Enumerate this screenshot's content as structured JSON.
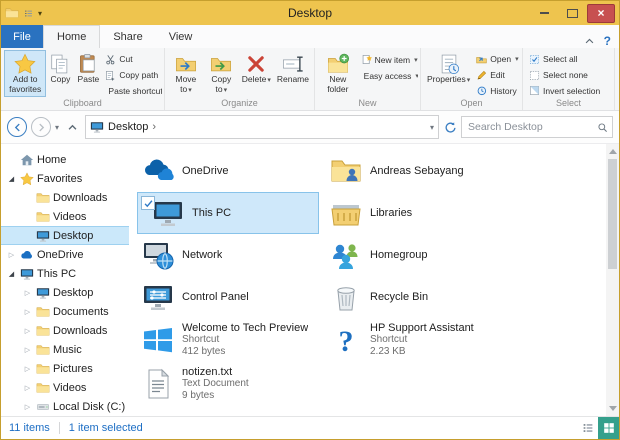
{
  "colors": {
    "titlebar_gold": "#eec44e",
    "file_tab_blue": "#2a72c0",
    "selection_blue": "#cbe8fa",
    "status_text_blue": "#1d6ec4",
    "active_view_teal": "#35a08c",
    "close_button_red": "#c75050"
  },
  "titlebar": {
    "title": "Desktop"
  },
  "ribbon": {
    "file_tab": "File",
    "tabs": [
      {
        "label": "Home",
        "active": true
      },
      {
        "label": "Share",
        "active": false
      },
      {
        "label": "View",
        "active": false
      }
    ],
    "help": "?",
    "groups": {
      "clipboard": {
        "label": "Clipboard",
        "add_to_favorites": "Add to favorites",
        "copy": "Copy",
        "paste": "Paste",
        "cut": "Cut",
        "copy_path": "Copy path",
        "paste_shortcut": "Paste shortcut"
      },
      "organize": {
        "label": "Organize",
        "move_to": "Move to",
        "copy_to": "Copy to",
        "delete": "Delete",
        "rename": "Rename"
      },
      "new": {
        "label": "New",
        "new_folder": "New folder",
        "new_item": "New item",
        "easy_access": "Easy access"
      },
      "open": {
        "label": "Open",
        "properties": "Properties",
        "open": "Open",
        "edit": "Edit",
        "history": "History"
      },
      "select": {
        "label": "Select",
        "select_all": "Select all",
        "select_none": "Select none",
        "invert_selection": "Invert selection"
      }
    }
  },
  "addressbar": {
    "breadcrumb_root": "Desktop",
    "search_placeholder": "Search Desktop"
  },
  "sidebar": {
    "items": [
      {
        "label": "Home",
        "icon": "home-icon",
        "level": 0,
        "expander": "none"
      },
      {
        "label": "Favorites",
        "icon": "star-icon",
        "level": 0,
        "expander": "expanded"
      },
      {
        "label": "Downloads",
        "icon": "folder-icon",
        "level": 1,
        "expander": "none"
      },
      {
        "label": "Videos",
        "icon": "folder-icon",
        "level": 1,
        "expander": "none"
      },
      {
        "label": "Desktop",
        "icon": "monitor-icon",
        "level": 1,
        "expander": "none",
        "selected": true
      },
      {
        "label": "OneDrive",
        "icon": "cloud-icon",
        "level": 0,
        "expander": "collapsed"
      },
      {
        "label": "This PC",
        "icon": "monitor-icon",
        "level": 0,
        "expander": "expanded"
      },
      {
        "label": "Desktop",
        "icon": "monitor-icon",
        "level": 1,
        "expander": "collapsed"
      },
      {
        "label": "Documents",
        "icon": "folder-icon",
        "level": 1,
        "expander": "collapsed"
      },
      {
        "label": "Downloads",
        "icon": "folder-icon",
        "level": 1,
        "expander": "collapsed"
      },
      {
        "label": "Music",
        "icon": "folder-icon",
        "level": 1,
        "expander": "collapsed"
      },
      {
        "label": "Pictures",
        "icon": "folder-icon",
        "level": 1,
        "expander": "collapsed"
      },
      {
        "label": "Videos",
        "icon": "folder-icon",
        "level": 1,
        "expander": "collapsed"
      },
      {
        "label": "Local Disk (C:)",
        "icon": "disk-icon",
        "level": 1,
        "expander": "collapsed"
      }
    ]
  },
  "files": {
    "col1": [
      {
        "name": "OneDrive",
        "icon": "onedrive-icon"
      },
      {
        "name": "This PC",
        "icon": "this-pc-icon",
        "selected": true
      },
      {
        "name": "Network",
        "icon": "network-icon"
      },
      {
        "name": "Control Panel",
        "icon": "control-panel-icon"
      },
      {
        "name": "Welcome to Tech Preview",
        "type": "Shortcut",
        "size": "412 bytes",
        "icon": "windows-icon"
      },
      {
        "name": "notizen.txt",
        "type": "Text Document",
        "size": "9 bytes",
        "icon": "text-file-icon"
      }
    ],
    "col2": [
      {
        "name": "Andreas Sebayang",
        "icon": "user-folder-icon"
      },
      {
        "name": "Libraries",
        "icon": "libraries-icon"
      },
      {
        "name": "Homegroup",
        "icon": "homegroup-icon"
      },
      {
        "name": "Recycle Bin",
        "icon": "recycle-bin-icon"
      },
      {
        "name": "HP Support Assistant",
        "type": "Shortcut",
        "size": "2.23 KB",
        "icon": "hp-icon"
      }
    ]
  },
  "statusbar": {
    "items_count": "11 items",
    "selected_count": "1 item selected"
  }
}
